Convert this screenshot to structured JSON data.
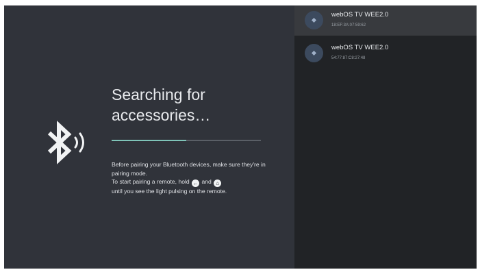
{
  "left": {
    "title": "Searching for\naccessories…",
    "progress": 0.5,
    "instructions": {
      "line1": "Before pairing your Bluetooth devices, make sure they're in pairing mode.",
      "line2_prefix": "To start pairing a remote, hold",
      "back_glyph": "←",
      "and": "and",
      "home_glyph": "⌂",
      "line3": "until you see the light pulsing on the remote."
    },
    "icon": "bluetooth-searching-icon"
  },
  "devices": [
    {
      "name": "webOS TV WEE2.0",
      "address": "18:EF:3A:07:59:62",
      "icon": "device-icon",
      "selected": true
    },
    {
      "name": "webOS TV WEE2.0",
      "address": "54:77:87:C8:27:48",
      "icon": "device-icon",
      "selected": false
    }
  ],
  "colors": {
    "background": "#30333a",
    "list_background": "#212326",
    "accent": "#7fc4b8"
  }
}
